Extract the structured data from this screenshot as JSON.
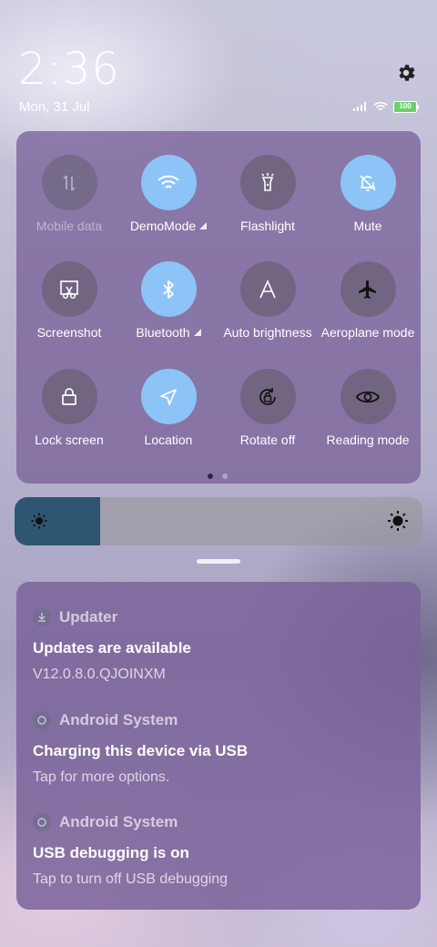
{
  "status_bar": {
    "time": "2:36",
    "date": "Mon, 31 Jul",
    "battery_level": "100",
    "icons": [
      "signal-icon",
      "wifi-icon",
      "battery-icon"
    ]
  },
  "quick_settings": {
    "tiles": [
      {
        "label": "Mobile data",
        "icon": "mobile-data-icon",
        "state": "unavailable"
      },
      {
        "label": "DemoMode",
        "icon": "wifi-icon",
        "state": "on"
      },
      {
        "label": "Flashlight",
        "icon": "flashlight-icon",
        "state": "off"
      },
      {
        "label": "Mute",
        "icon": "bell-off-icon",
        "state": "on"
      },
      {
        "label": "Screenshot",
        "icon": "screenshot-icon",
        "state": "off"
      },
      {
        "label": "Bluetooth",
        "icon": "bluetooth-icon",
        "state": "on"
      },
      {
        "label": "Auto brightness",
        "icon": "auto-brightness-icon",
        "state": "off"
      },
      {
        "label": "Aeroplane mode",
        "icon": "airplane-icon",
        "state": "off"
      },
      {
        "label": "Lock screen",
        "icon": "lock-icon",
        "state": "off"
      },
      {
        "label": "Location",
        "icon": "location-icon",
        "state": "on"
      },
      {
        "label": "Rotate off",
        "icon": "rotate-lock-icon",
        "state": "off"
      },
      {
        "label": "Reading mode",
        "icon": "eye-icon",
        "state": "off"
      }
    ],
    "page_count": 2,
    "current_page": 1
  },
  "brightness": {
    "level": 0.21,
    "low_icon": "sun-low-icon",
    "high_icon": "sun-high-icon"
  },
  "notifications": [
    {
      "app": "Updater",
      "title": "Updates are available",
      "body": "V12.0.8.0.QJOINXM"
    },
    {
      "app": "Android System",
      "title": "Charging this device via USB",
      "body": "Tap for more options."
    },
    {
      "app": "Android System",
      "title": "USB debugging is on",
      "body": "Tap to turn off USB debugging"
    }
  ],
  "colors": {
    "accent": "#8cc4f8",
    "panel": "#7a639a",
    "brightness_fill": "#2e5672"
  }
}
